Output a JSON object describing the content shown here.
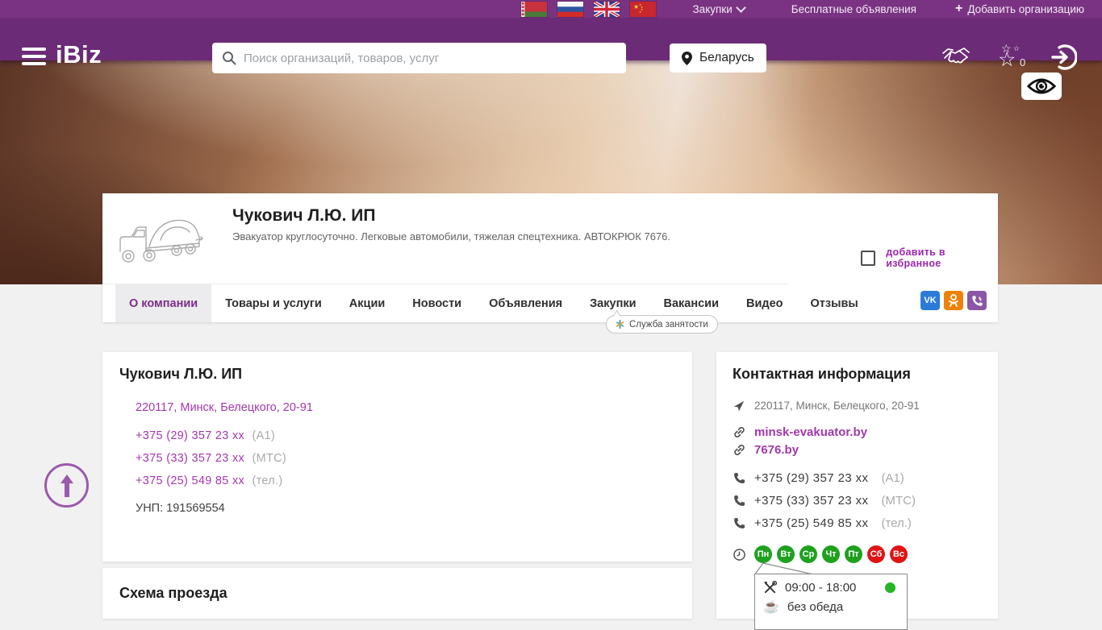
{
  "colors": {
    "header_purple": "#6c2b76",
    "topbar_purple": "#7a3383",
    "link_purple": "#a238ae",
    "active_tab_purple": "#7b2d8b",
    "favorite_purple": "#9c27b0",
    "day_open_green": "#1fa11f",
    "day_closed_red": "#e01414",
    "open_dot_green": "#27b427",
    "vk_blue": "#2a7cd8",
    "ok_orange": "#ee8208",
    "viber_purple": "#8a56a5"
  },
  "topbar": {
    "flags": [
      "belarus",
      "russia",
      "uk",
      "china"
    ],
    "procurement_label": "Закупки",
    "free_ads_label": "Бесплатные объявления",
    "add_org_label": "Добавить организацию"
  },
  "header": {
    "logo": "iBiz",
    "search_placeholder": "Поиск организаций, товаров, услуг",
    "location_label": "Беларусь",
    "favorites_count": "0"
  },
  "company": {
    "name": "Чукович Л.Ю. ИП",
    "description": "Эвакуатор круглосуточно. Легковые автомобили, тяжелая спецтехника. АВТОКРЮК 7676.",
    "favorite_label": "добавить в избранное"
  },
  "tabs": [
    {
      "label": "О компании",
      "active": true
    },
    {
      "label": "Товары и услуги",
      "active": false
    },
    {
      "label": "Акции",
      "active": false
    },
    {
      "label": "Новости",
      "active": false
    },
    {
      "label": "Объявления",
      "active": false
    },
    {
      "label": "Закупки",
      "active": false
    },
    {
      "label": "Вакансии",
      "active": false
    },
    {
      "label": "Видео",
      "active": false
    },
    {
      "label": "Отзывы",
      "active": false
    }
  ],
  "vacancy_tooltip": "Служба занятости",
  "info_card": {
    "title": "Чукович Л.Ю. ИП",
    "address": "220117, Минск, Белецкого, 20-91",
    "phones": [
      {
        "number": "+375 (29) 357 23 xx",
        "operator": "(А1)"
      },
      {
        "number": "+375 (33) 357 23 xx",
        "operator": "(МТС)"
      },
      {
        "number": "+375 (25) 549 85 xx",
        "operator": "(тел.)"
      }
    ],
    "unp": "УНП: 191569554"
  },
  "map_card": {
    "title": "Схема проезда"
  },
  "contact_card": {
    "title": "Контактная информация",
    "address": "220117, Минск, Белецкого, 20-91",
    "websites": [
      "minsk-evakuator.by",
      "7676.by"
    ],
    "phones": [
      {
        "number": "+375 (29) 357 23 xx",
        "operator": "(А1)"
      },
      {
        "number": "+375 (33) 357 23 xx",
        "operator": "(МТС)"
      },
      {
        "number": "+375 (25) 549 85 xx",
        "operator": "(тел.)"
      }
    ],
    "days": [
      {
        "label": "Пн",
        "status": "open"
      },
      {
        "label": "Вт",
        "status": "open"
      },
      {
        "label": "Ср",
        "status": "open"
      },
      {
        "label": "Чт",
        "status": "open"
      },
      {
        "label": "Пт",
        "status": "open"
      },
      {
        "label": "Сб",
        "status": "closed"
      },
      {
        "label": "Вс",
        "status": "closed"
      }
    ],
    "hours_popup": {
      "time": "09:00 - 18:00",
      "lunch": "без обеда"
    }
  }
}
